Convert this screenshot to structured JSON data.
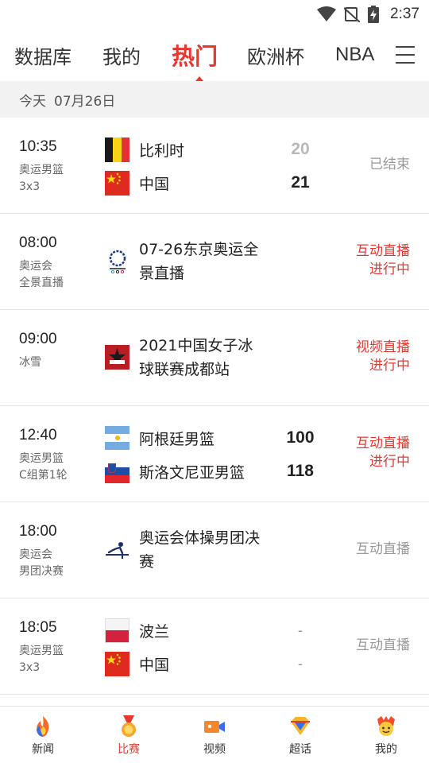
{
  "status_bar": {
    "time": "2:37"
  },
  "tabs": [
    {
      "label": "数据库"
    },
    {
      "label": "我的"
    },
    {
      "label": "热门"
    },
    {
      "label": "欧洲杯"
    },
    {
      "label": "NBA"
    }
  ],
  "date_bar": {
    "day": "今天",
    "date": "07月26日"
  },
  "matches": [
    {
      "time": "10:35",
      "category_line1": "奥运男篮",
      "category_line2": "3x3",
      "team1": "比利时",
      "team2": "中国",
      "score1": "20",
      "score2": "21",
      "status_line1": "已结束",
      "status_line2": ""
    },
    {
      "time": "08:00",
      "category_line1": "奥运会",
      "category_line2": "全景直播",
      "title": "07-26东京奥运全景直播",
      "status_line1": "互动直播",
      "status_line2": "进行中"
    },
    {
      "time": "09:00",
      "category_line1": "冰雪",
      "category_line2": "",
      "title": "2021中国女子冰球联赛成都站",
      "status_line1": "视频直播",
      "status_line2": "进行中"
    },
    {
      "time": "12:40",
      "category_line1": "奥运男篮",
      "category_line2": "C组第1轮",
      "team1": "阿根廷男篮",
      "team2": "斯洛文尼亚男篮",
      "score1": "100",
      "score2": "118",
      "status_line1": "互动直播",
      "status_line2": "进行中"
    },
    {
      "time": "18:00",
      "category_line1": "奥运会",
      "category_line2": "男团决赛",
      "title": "奥运会体操男团决赛",
      "status_line1": "互动直播",
      "status_line2": ""
    },
    {
      "time": "18:05",
      "category_line1": "奥运男篮",
      "category_line2": "3x3",
      "team1": "波兰",
      "team2": "中国",
      "score1": "-",
      "score2": "-",
      "status_line1": "互动直播",
      "status_line2": ""
    }
  ],
  "bottom_nav": [
    {
      "label": "新闻",
      "icon": "news-flame-icon"
    },
    {
      "label": "比赛",
      "icon": "medal-icon"
    },
    {
      "label": "视频",
      "icon": "video-camera-icon"
    },
    {
      "label": "超话",
      "icon": "diamond-chat-icon"
    },
    {
      "label": "我的",
      "icon": "profile-mascot-icon"
    }
  ],
  "colors": {
    "accent": "#e8372f",
    "divider": "#e6e6e6",
    "date_bar_bg": "#f2f2f2"
  }
}
